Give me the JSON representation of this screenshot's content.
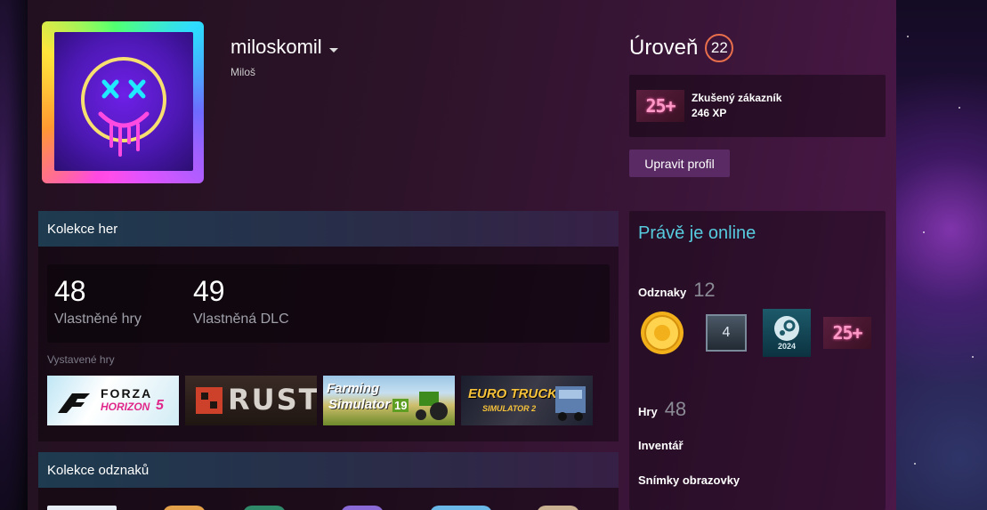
{
  "profile": {
    "persona_name": "miloskomil",
    "real_name": "Miloš"
  },
  "level": {
    "label": "Úroveň",
    "value": "22"
  },
  "featured_badge": {
    "title": "Zkušený zákazník",
    "xp": "246 XP",
    "icon_text": "25+"
  },
  "edit_profile_label": "Upravit profil",
  "game_collection": {
    "title": "Kolekce her",
    "owned_games": "48",
    "owned_games_label": "Vlastněné hry",
    "owned_dlc": "49",
    "owned_dlc_label": "Vlastněná DLC",
    "featured_label": "Vystavené hry",
    "games": [
      {
        "name": "Forza Horizon 5",
        "logo_top": "FORZA",
        "logo_bottom": "HORIZON",
        "logo_num": "5"
      },
      {
        "name": "Rust",
        "logo": "RUST"
      },
      {
        "name": "Farming Simulator 19",
        "logo_top": "Farming",
        "logo_bottom": "Simulator",
        "logo_num": "19"
      },
      {
        "name": "Euro Truck Simulator 2",
        "logo_top": "EURO TRUCK",
        "logo_bottom": "SIMULATOR 2"
      }
    ]
  },
  "badge_collection": {
    "title": "Kolekce odznaků"
  },
  "right_panel": {
    "status": "Právě je online",
    "badges_label": "Odznaky",
    "badges_count": "12",
    "badge_icons": [
      {
        "name": "gold-coin-icon"
      },
      {
        "name": "years-of-service-icon",
        "text": "4"
      },
      {
        "name": "steam-2024-icon",
        "text": "2024"
      },
      {
        "name": "customer-25-icon",
        "text": "25+"
      }
    ],
    "games_label": "Hry",
    "games_count": "48",
    "inventory_label": "Inventář",
    "screenshots_label": "Snímky obrazovky"
  },
  "colors": {
    "accent_online": "#57cbde",
    "level_ring": "#e86f4b",
    "button_bg": "#5a2a64"
  }
}
